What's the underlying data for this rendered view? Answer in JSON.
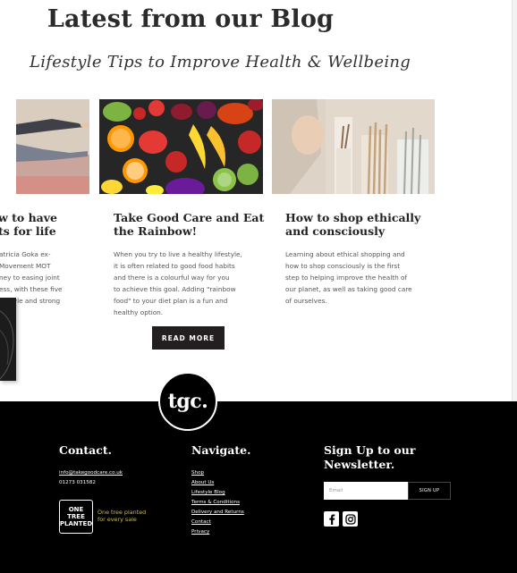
{
  "blog": {
    "title": "Latest from our Blog",
    "subtitle": "Lifestyle Tips to Improve Health & Wellbeing",
    "read_more_label": "READ MORE",
    "cards": [
      {
        "title_lines": [
          "w to have",
          "ts for life"
        ],
        "excerpt_lines": [
          "atricia Goka ex-",
          "Movement MOT",
          "ney to easing joint",
          "ess, with these five",
          "ifestyle and strong"
        ]
      },
      {
        "title_lines": [
          "Take Good Care and Eat",
          "the Rainbow!"
        ],
        "excerpt_lines": [
          "When you try to live a healthy lifestyle,",
          "it is often related to good food habits",
          "and there is a colourful way for you",
          "to achieve this goal. Adding \"rainbow",
          "food\" to your diet plan is a fun and",
          "healthy option."
        ]
      },
      {
        "title_lines": [
          "How to shop ethically",
          "and consciously"
        ],
        "excerpt_lines": [
          "Learning about ethical shopping and",
          "how to shop consciously is the first",
          "step to helping improve the health of",
          "our planet, as well as taking good care",
          "of ourselves."
        ]
      }
    ]
  },
  "footer": {
    "logo_text": "tgc.",
    "contact": {
      "heading": "Contact.",
      "email": "info@takegoodcare.co.uk",
      "phone": "01273 031582"
    },
    "badge": {
      "lines": [
        "ONE",
        "TREE",
        "PLANTED"
      ],
      "caption_lines": [
        "One tree planted",
        "for every sale"
      ]
    },
    "navigate": {
      "heading": "Navigate.",
      "links": [
        "Shop",
        "About Us",
        "Lifestyle Blog",
        "Terms & Conditions",
        "Delivery and Returns",
        "Contact",
        "Privacy"
      ]
    },
    "newsletter": {
      "heading_lines": [
        "Sign Up to our",
        "Newsletter."
      ],
      "email_placeholder": "Email",
      "signup_label": "SIGN UP"
    },
    "social_icons": [
      "facebook-icon",
      "instagram-icon"
    ]
  },
  "colors": {
    "footer_bg": "#000000",
    "button_bg": "#231f20",
    "badge_caption": "#c8bd5a"
  }
}
